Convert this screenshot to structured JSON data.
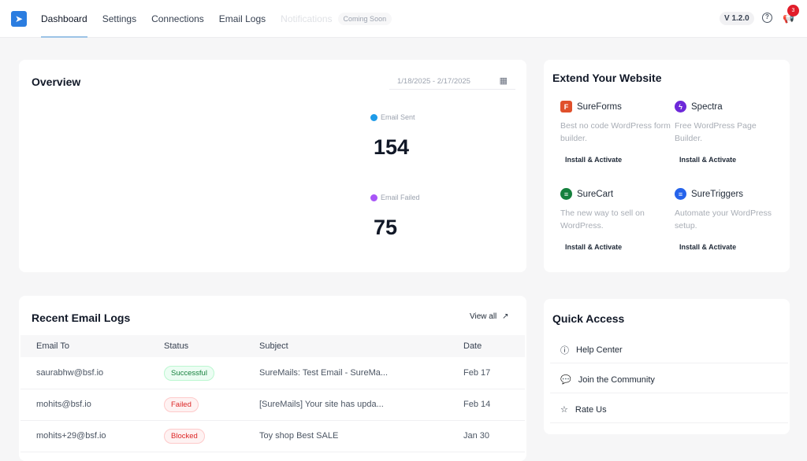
{
  "nav": {
    "items": [
      "Dashboard",
      "Settings",
      "Connections",
      "Email Logs",
      "Notifications"
    ],
    "coming_soon": "Coming Soon",
    "version": "V 1.2.0",
    "notification_count": "3"
  },
  "overview": {
    "title": "Overview",
    "date_range": "1/18/2025 - 2/17/2025",
    "sent_label": "Email Sent",
    "sent_value": "154",
    "failed_label": "Email Failed",
    "failed_value": "75",
    "sent_color": "#1e9be8",
    "failed_color": "#a855f7"
  },
  "extend": {
    "title": "Extend Your Website",
    "products": [
      {
        "name": "SureForms",
        "desc": "Best no code WordPress form builder.",
        "button": "Install & Activate",
        "color": "#e0502b"
      },
      {
        "name": "Spectra",
        "desc": "Free WordPress Page Builder.",
        "button": "Install & Activate",
        "color": "#6d28d9"
      },
      {
        "name": "SureCart",
        "desc": "The new way to sell on WordPress.",
        "button": "Install & Activate",
        "color": "#15803d"
      },
      {
        "name": "SureTriggers",
        "desc": "Automate your WordPress setup.",
        "button": "Install & Activate",
        "color": "#2563eb"
      }
    ]
  },
  "logs": {
    "title": "Recent Email Logs",
    "view_all": "View all",
    "columns": [
      "Email To",
      "Status",
      "Subject",
      "Date"
    ],
    "rows": [
      {
        "to": "saurabhw@bsf.io",
        "status": "Successful",
        "subject": "SureMails: Test Email - SureMa...",
        "date": "Feb 17"
      },
      {
        "to": "mohits@bsf.io",
        "status": "Failed",
        "subject": "[SureMails] Your site has upda...",
        "date": "Feb 14"
      },
      {
        "to": "mohits+29@bsf.io",
        "status": "Blocked",
        "subject": "Toy shop Best SALE",
        "date": "Jan 30"
      }
    ]
  },
  "quick": {
    "title": "Quick Access",
    "items": [
      "Help Center",
      "Join the Community",
      "Rate Us"
    ]
  }
}
